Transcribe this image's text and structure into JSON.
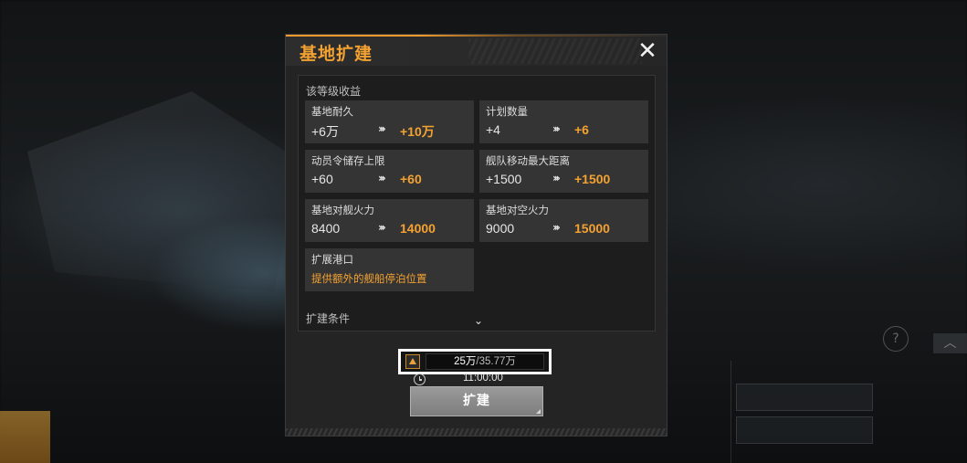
{
  "dialog": {
    "title": "基地扩建",
    "close_icon": "close-icon",
    "section_benefits": "该等级收益",
    "section_conditions": "扩建条件",
    "cards": [
      {
        "label": "基地耐久",
        "old": "+6万",
        "new": "+10万"
      },
      {
        "label": "计划数量",
        "old": "+4",
        "new": "+6"
      },
      {
        "label": "动员令储存上限",
        "old": "+60",
        "new": "+60"
      },
      {
        "label": "舰队移动最大距离",
        "old": "+1500",
        "new": "+1500"
      },
      {
        "label": "基地对舰火力",
        "old": "8400",
        "new": "14000"
      },
      {
        "label": "基地对空火力",
        "old": "9000",
        "new": "15000"
      }
    ],
    "port": {
      "label": "扩展港口",
      "desc": "提供额外的舰船停泊位置"
    },
    "arrow_glyph": "›››",
    "chevron_glyph": "⌄"
  },
  "cost": {
    "current": "25万",
    "separator": "/",
    "total": "35.77万"
  },
  "time": "11:00:00",
  "button": {
    "label": "扩建"
  },
  "colors": {
    "accent": "#f3a232",
    "panel": "#242424",
    "card": "#343434"
  }
}
